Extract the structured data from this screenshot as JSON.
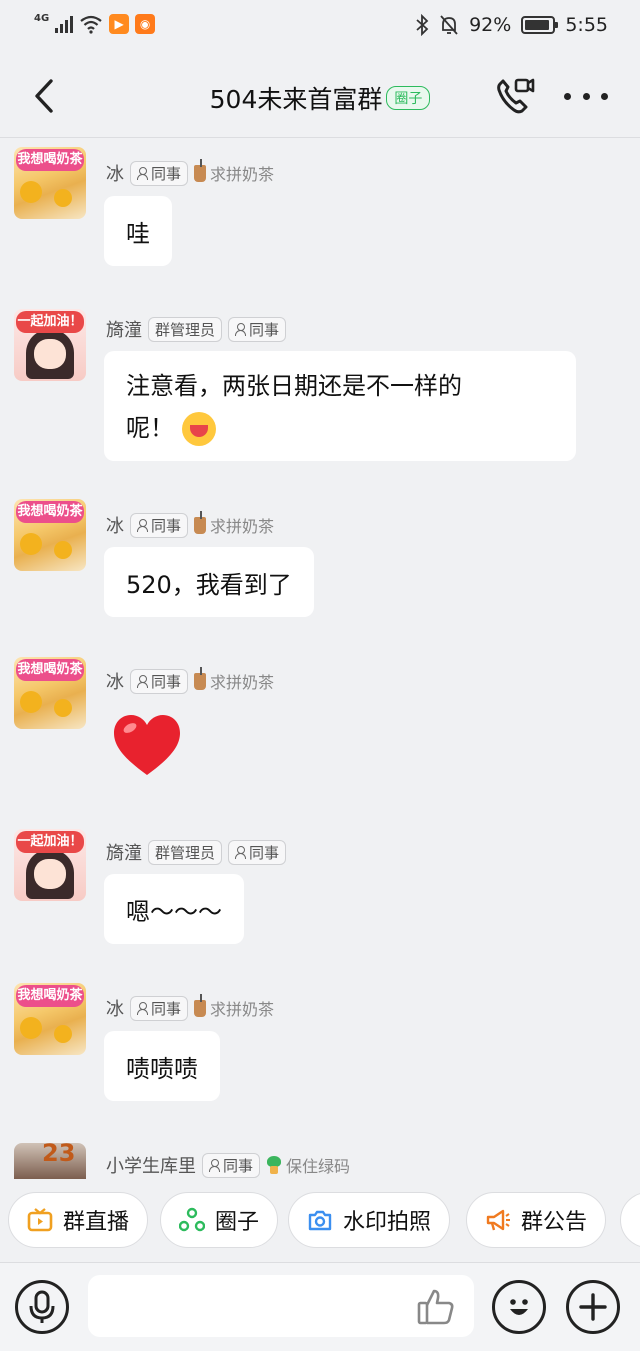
{
  "status_bar": {
    "network": "4G",
    "battery": "92%",
    "battery_level": 0.92,
    "time": "5:55"
  },
  "header": {
    "title": "504未来首富群",
    "tag": "圈子",
    "back_icon": "chevron-left-icon",
    "call_icon": "video-call-icon",
    "more_icon": "more-dots-icon"
  },
  "messages": [
    {
      "sender": "冰",
      "badges": [
        "同事"
      ],
      "title": "求拼奶茶",
      "text": "哇"
    },
    {
      "sender": "旖潼",
      "badges": [
        "群管理员",
        "同事"
      ],
      "title": "",
      "text_line1": "注意看，两张日期还是不一样的",
      "text_line2": "呢！"
    },
    {
      "sender": "冰",
      "badges": [
        "同事"
      ],
      "title": "求拼奶茶",
      "text": "520，我看到了"
    },
    {
      "sender": "冰",
      "badges": [
        "同事"
      ],
      "title": "求拼奶茶",
      "text": ""
    },
    {
      "sender": "旖潼",
      "badges": [
        "群管理员",
        "同事"
      ],
      "title": "",
      "text": "嗯～～～"
    },
    {
      "sender": "冰",
      "badges": [
        "同事"
      ],
      "title": "求拼奶茶",
      "text": "啧啧啧"
    },
    {
      "sender": "小学生库里",
      "badges": [
        "同事"
      ],
      "title": "保住绿码",
      "text": ""
    }
  ],
  "avatars": {
    "bing_tag": "我想喝奶茶",
    "qi_tag": "一起加油！",
    "xiao_num": "23"
  },
  "quick_actions": [
    {
      "label": "群直播",
      "icon": "live-tv-icon",
      "color": "#f0a020"
    },
    {
      "label": "圈子",
      "icon": "circle-share-icon",
      "color": "#2dbb5d"
    },
    {
      "label": "水印拍照",
      "icon": "camera-icon",
      "color": "#3b8ff0"
    },
    {
      "label": "群公告",
      "icon": "megaphone-icon",
      "color": "#f07a20"
    }
  ],
  "input_bar": {
    "voice_icon": "microphone-icon",
    "like_icon": "thumbs-up-icon",
    "emoji_icon": "smiley-icon",
    "add_icon": "plus-icon"
  }
}
